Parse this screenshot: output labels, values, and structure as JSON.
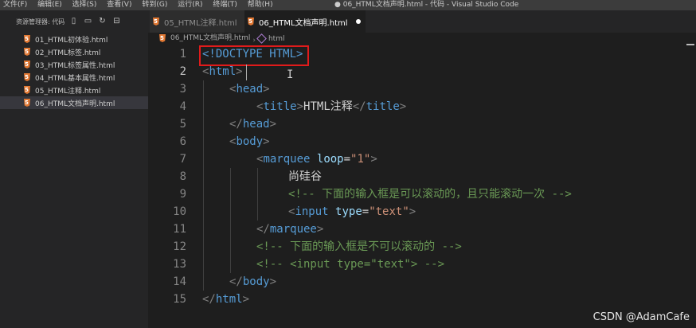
{
  "window_title": "● 06_HTML文档声明.html - 代码 - Visual Studio Code",
  "menu": [
    "文件(F)",
    "编辑(E)",
    "选择(S)",
    "查看(V)",
    "转到(G)",
    "运行(R)",
    "终端(T)",
    "帮助(H)"
  ],
  "explorer": {
    "title": "资源管理器: 代码",
    "files": [
      "01_HTML初体验.html",
      "02_HTML标签.html",
      "03_HTML标签属性.html",
      "04_HTML基本属性.html",
      "05_HTML注释.html",
      "06_HTML文档声明.html"
    ],
    "active_index": 5
  },
  "tabs": [
    "05_HTML注释.html",
    "06_HTML文档声明.html"
  ],
  "breadcrumb": {
    "file": "06_HTML文档声明.html",
    "symbol": "html"
  },
  "code": {
    "line_numbers": [
      "1",
      "2",
      "3",
      "4",
      "5",
      "6",
      "7",
      "8",
      "9",
      "10",
      "11",
      "12",
      "13",
      "14",
      "15"
    ],
    "l1": "<!DOCTYPE HTML>",
    "l2_open": "<",
    "l2_tag": "html",
    "l2_close": ">",
    "l3_tag": "head",
    "l4_tag": "title",
    "l4_text": "HTML注释",
    "l5_tag": "head",
    "l6_tag": "body",
    "l7_tag": "marquee",
    "l7_attr": "loop",
    "l7_val": "\"1\"",
    "l8_text": "尚硅谷",
    "l9_comment": "<!-- 下面的输入框是可以滚动的，且只能滚动一次 -->",
    "l10_tag": "input",
    "l10_attr": "type",
    "l10_val": "\"text\"",
    "l11_tag": "marquee",
    "l12_comment": "<!-- 下面的输入框是不可以滚动的 -->",
    "l13_comment": "<!-- <input type=\"text\"> -->",
    "l14_tag": "body",
    "l15_tag": "html"
  },
  "watermark": "CSDN @AdamCafe",
  "colors": {
    "highlight_box": "#e01b1b",
    "tag": "#569cd6",
    "attr": "#9cdcfe",
    "string": "#ce9178",
    "comment": "#6a9955"
  }
}
